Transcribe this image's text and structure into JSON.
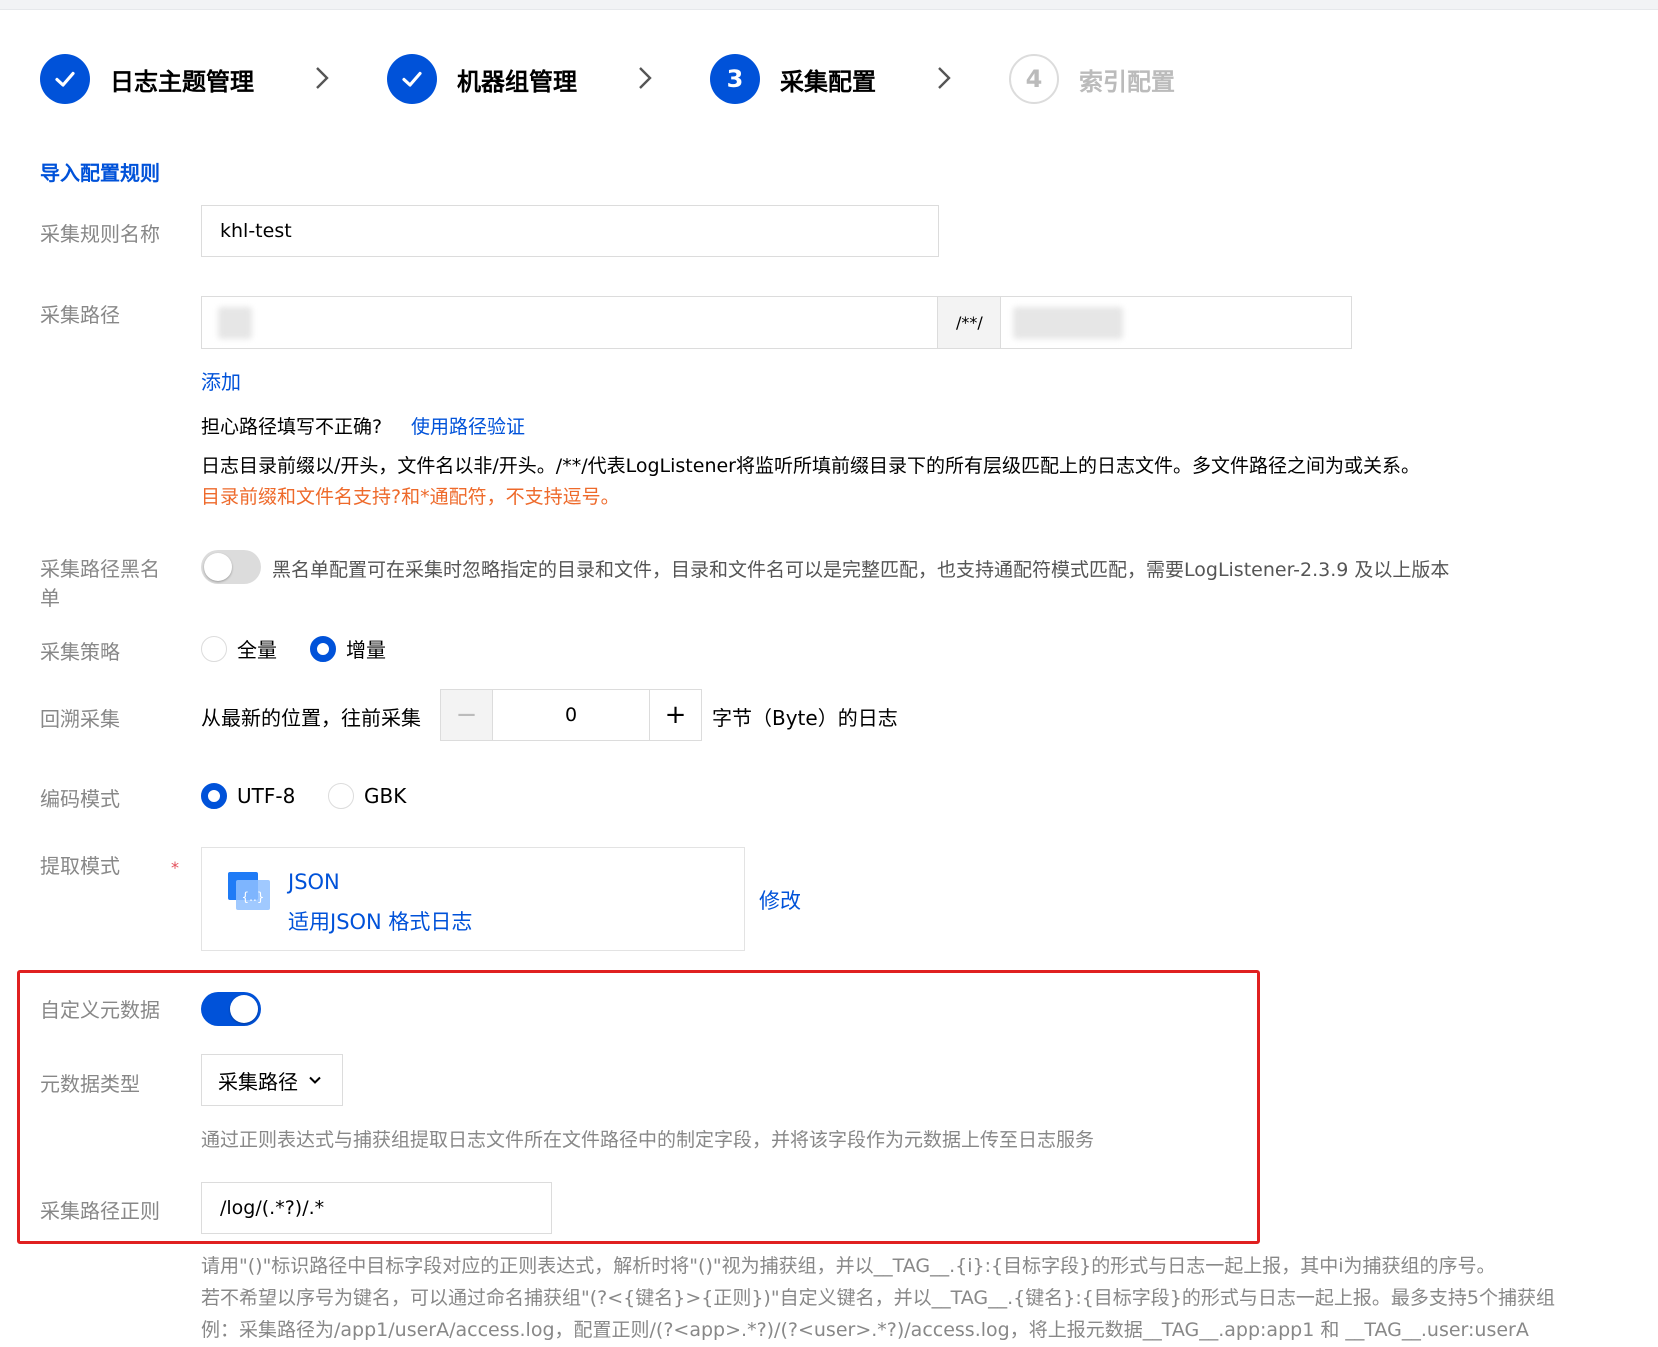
{
  "steps": [
    {
      "label": "日志主题管理",
      "state": "done"
    },
    {
      "label": "机器组管理",
      "state": "done"
    },
    {
      "label": "采集配置",
      "state": "active",
      "number": "3"
    },
    {
      "label": "索引配置",
      "state": "pending",
      "number": "4"
    }
  ],
  "import_link": "导入配置规则",
  "rule_name": {
    "label": "采集规则名称",
    "value": "khl-test"
  },
  "collect_path": {
    "label": "采集路径",
    "separator": "/**/",
    "add_link": "添加",
    "verify_question": "担心路径填写不正确?",
    "verify_link": "使用路径验证",
    "description": "日志目录前缀以/开头，文件名以非/开头。/**/代表LogListener将监听所填前缀目录下的所有层级匹配上的日志文件。多文件路径之间为或关系。",
    "warning": "目录前缀和文件名支持?和*通配符，不支持逗号。"
  },
  "blacklist": {
    "label_line1": "采集路径黑名",
    "label_line2": "单",
    "enabled": false,
    "description": "黑名单配置可在采集时忽略指定的目录和文件，目录和文件名可以是完整匹配，也支持通配符模式匹配，需要LogListener-2.3.9 及以上版本"
  },
  "strategy": {
    "label": "采集策略",
    "options": [
      "全量",
      "增量"
    ],
    "selected": "增量"
  },
  "backtrack": {
    "label": "回溯采集",
    "prefix": "从最新的位置，往前采集",
    "minus": "−",
    "value": "0",
    "plus": "+",
    "suffix": "字节（Byte）的日志"
  },
  "encoding": {
    "label": "编码模式",
    "options": [
      "UTF-8",
      "GBK"
    ],
    "selected": "UTF-8"
  },
  "extract": {
    "label": "提取模式",
    "required_mark": "*",
    "mode_title": "JSON",
    "mode_desc": "适用JSON 格式日志",
    "modify_link": "修改"
  },
  "custom_metadata": {
    "label": "自定义元数据",
    "enabled": true,
    "type_label": "元数据类型",
    "type_value": "采集路径",
    "type_help": "通过正则表达式与捕获组提取日志文件所在文件路径中的制定字段，并将该字段作为元数据上传至日志服务",
    "regex_label": "采集路径正则",
    "regex_value": "/log/(.*?)/.*",
    "regex_help_1": "请用\"()\"标识路径中目标字段对应的正则表达式，解析时将\"()\"视为捕获组，并以__TAG__.{i}:{目标字段}的形式与日志一起上报，其中i为捕获组的序号。",
    "regex_help_2": "若不希望以序号为键名，可以通过命名捕获组\"(?<{键名}>{正则})\"自定义键名，并以__TAG__.{键名}:{目标字段}的形式与日志一起上报。最多支持5个捕获组",
    "regex_help_3": "例：采集路径为/app1/userA/access.log，配置正则/(?<app>.*?)/(?<user>.*?)/access.log，将上报元数据__TAG__.app:app1 和 __TAG__.user:userA"
  },
  "colors": {
    "primary": "#0052d9",
    "warning": "#ee6a2b",
    "highlight_border": "#e02020"
  }
}
